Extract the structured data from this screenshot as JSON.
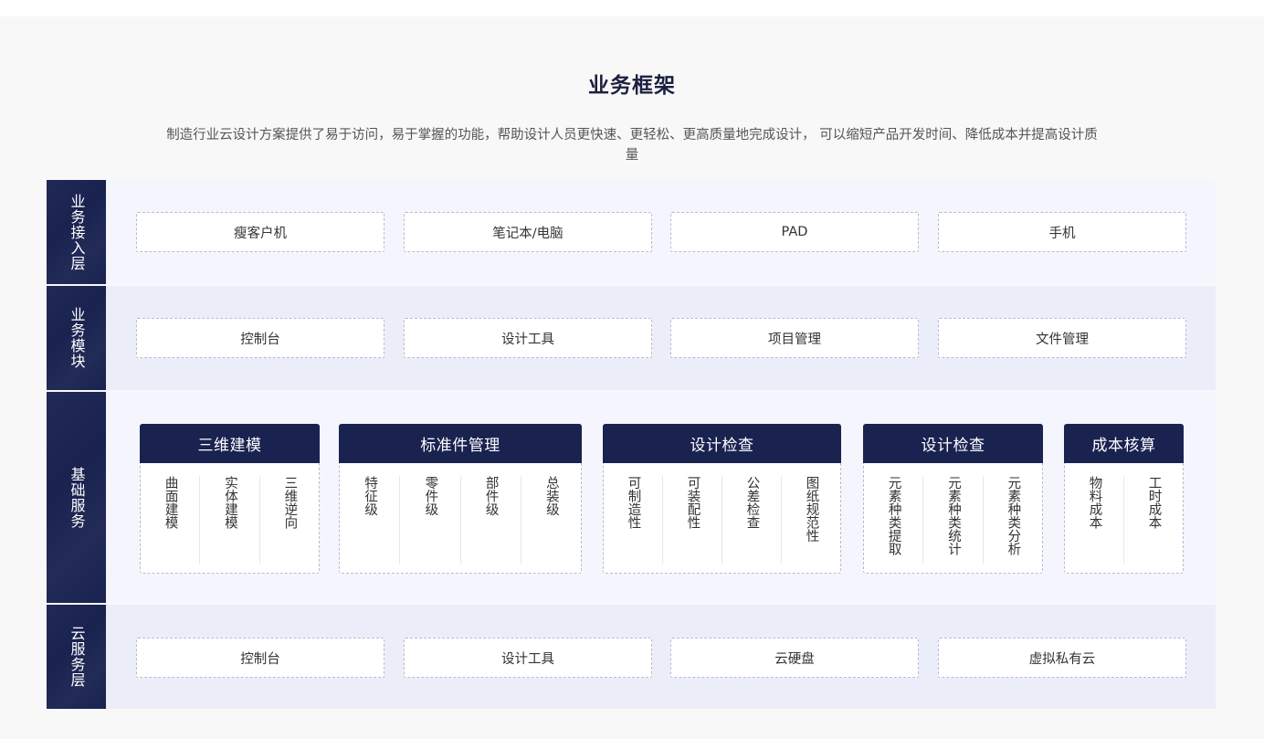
{
  "title": "业务框架",
  "description": "制造行业云设计方案提供了易于访问，易于掌握的功能，帮助设计人员更快速、更轻松、更高质量地完成设计， 可以缩短产品开发时间、降低成本并提高设计质量",
  "layers": [
    {
      "label": "业务接入层",
      "items": [
        "瘦客户机",
        "笔记本/电脑",
        "PAD",
        "手机"
      ]
    },
    {
      "label": "业务模块",
      "items": [
        "控制台",
        "设计工具",
        "项目管理",
        "文件管理"
      ]
    },
    {
      "label": "基础服务",
      "groups": [
        {
          "title": "三维建模",
          "items": [
            "曲面建模",
            "实体建模",
            "三维逆向"
          ]
        },
        {
          "title": "标准件管理",
          "items": [
            "特征级",
            "零件级",
            "部件级",
            "总装级"
          ]
        },
        {
          "title": "设计检查",
          "items": [
            "可制造性",
            "可装配性",
            "公差检查",
            "图纸规范性"
          ]
        },
        {
          "title": "设计检查",
          "items": [
            "元素种类提取",
            "元素种类统计",
            "元素种类分析"
          ]
        },
        {
          "title": "成本核算",
          "items": [
            "物料成本",
            "工时成本"
          ]
        }
      ]
    },
    {
      "label": "云服务层",
      "items": [
        "控制台",
        "设计工具",
        "云硬盘",
        "虚拟私有云"
      ]
    }
  ],
  "colors": {
    "navy": "#1a2250",
    "row_light": "#f5f6fd",
    "row_mid": "#ebedf9",
    "title": "#1c2040"
  }
}
